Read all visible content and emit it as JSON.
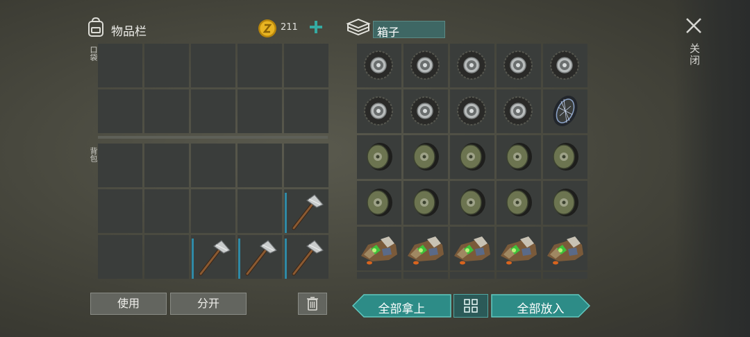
{
  "inventory": {
    "title": "物品栏",
    "coins": "211",
    "pocket_label": "口袋",
    "backpack_label": "背包",
    "pocket_slots": [
      "",
      "",
      "",
      "",
      "",
      "",
      "",
      "",
      "",
      ""
    ],
    "backpack_slots": [
      "",
      "",
      "",
      "",
      "",
      "",
      "",
      "",
      "",
      "axe",
      "",
      "",
      "axe",
      "axe",
      "axe"
    ],
    "use_button": "使用",
    "split_button": "分开"
  },
  "box": {
    "title": "箱子",
    "slots": [
      "tire",
      "tire",
      "tire",
      "tire",
      "tire",
      "tire",
      "tire",
      "tire",
      "tire",
      "bicycle-wheel",
      "wheel-rim",
      "wheel-rim",
      "wheel-rim",
      "wheel-rim",
      "wheel-rim",
      "wheel-rim",
      "wheel-rim",
      "wheel-rim",
      "wheel-rim",
      "wheel-rim",
      "scrap-parts",
      "scrap-parts",
      "scrap-parts",
      "scrap-parts",
      "scrap-parts"
    ],
    "take_all_button": "全部拿上",
    "put_all_button": "全部放入"
  },
  "close_label": "关闭",
  "colors": {
    "accent_teal": "#2f8a86",
    "teal_border": "#5fc2ba",
    "panel_cell": "#3a3d3b",
    "durability_blue": "#2f8aa6"
  }
}
